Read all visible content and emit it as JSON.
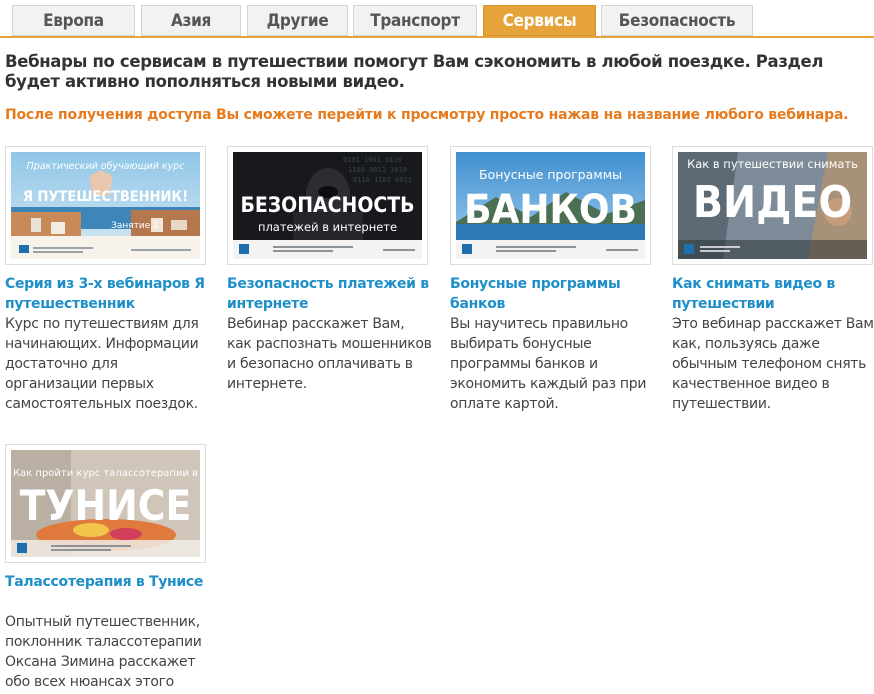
{
  "tabs": [
    {
      "label": "Европа",
      "active": false
    },
    {
      "label": "Азия",
      "active": false
    },
    {
      "label": "Другие",
      "active": false
    },
    {
      "label": "Транспорт",
      "active": false
    },
    {
      "label": "Сервисы",
      "active": true
    },
    {
      "label": "Безопасность",
      "active": false
    }
  ],
  "intro": "Вебнары по сервисам в путешествии помогут Вам сэкономить в любой поездке. Раздел будет активно пополняться новыми видео.",
  "notice": "После получения доступа Вы сможете перейти к просмотру просто нажав на название любого вебинара.",
  "webinars": [
    {
      "title": "Серия из 3-х вебинаров Я путешественник",
      "description": "Курс по путешествиям для начинающих. Информации достаточно для организации первых самостоятельных поездок.",
      "thumb": {
        "line1": "Практический обучающий курс",
        "line2": "Я ПУТЕШЕСТВЕННИК!",
        "line3": "Занятие 1"
      }
    },
    {
      "title": "Безопасность платежей в интернете",
      "description": "Вебинар расскажет Вам, как распознать мошенников и безопасно оплачивать в интернете.",
      "thumb": {
        "line1": "БЕЗОПАСНОСТЬ",
        "line2": "платежей в интернете"
      }
    },
    {
      "title": "Бонусные программы банков",
      "description": "Вы научитесь правильно выбирать бонусные программы банков и экономить каждый раз при оплате картой.",
      "thumb": {
        "line1": "Бонусные программы",
        "line2": "БАНКОВ"
      }
    },
    {
      "title": "Как снимать видео в путешествии",
      "description": "Это вебинар расскажет Вам как, пользуясь даже обычным телефоном снять качественное видео в путешествии.",
      "thumb": {
        "line1": "Как в путешествии снимать",
        "line2": "ВИДЕО"
      }
    },
    {
      "title": "Талассотерапия в Тунисе",
      "description": "Опытный путешественник, поклонник талассотерапии Оксана Зимина расскажет обо всех нюансах этого мощного оздоровления.",
      "thumb": {
        "line1": "Как пройти курс талассотерапии в",
        "line2": "ТУНИСЕ"
      }
    }
  ],
  "colors": {
    "accent": "#e6a33a",
    "notice": "#e57b1e",
    "link": "#1e8fc8"
  }
}
